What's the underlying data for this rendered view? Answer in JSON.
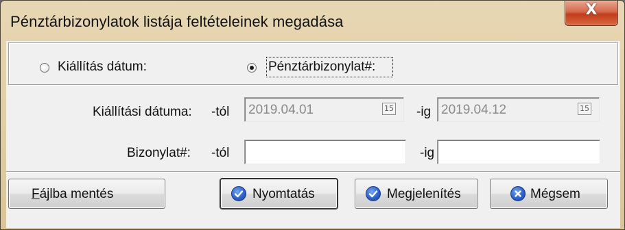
{
  "window": {
    "title": "Pénztárbizonylatok listája feltételeinek megadása",
    "close_glyph": "X"
  },
  "radio": {
    "option1_label": "Kiállítás dátum:",
    "option2_label": "Pénztárbizonylat#:",
    "selected": "option2"
  },
  "date_row": {
    "label": "Kiállítási dátuma:",
    "from_label": "-tól",
    "from_value": "2019.04.01",
    "to_label": "-ig",
    "to_value": "2019.04.12",
    "calendar_text": "15"
  },
  "doc_row": {
    "label": "Bizonylat#:",
    "from_label": "-tól",
    "from_value": "",
    "to_label": "-ig",
    "to_value": ""
  },
  "buttons": {
    "save_to_file_mnemonic": "F",
    "save_to_file_rest": "ájlba mentés",
    "print_label": "Nyomtatás",
    "display_label": "Megjelenítés",
    "cancel_label": "Mégsem"
  },
  "icons": {
    "print": "check-icon",
    "display": "check-icon",
    "cancel": "cancel-icon"
  }
}
